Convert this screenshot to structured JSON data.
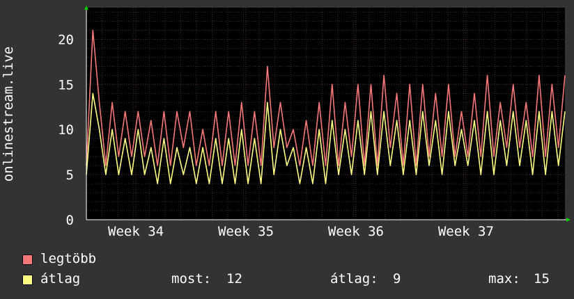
{
  "chart_data": {
    "type": "line",
    "ylabel": "onlinestream.live",
    "yticks": [
      0,
      5,
      10,
      15,
      20
    ],
    "ylim": [
      0,
      23.5
    ],
    "xlim": [
      33.55,
      37.9
    ],
    "xticks": [
      {
        "label": "Week 34",
        "x": 34
      },
      {
        "label": "Week 35",
        "x": 35
      },
      {
        "label": "Week 36",
        "x": 36
      },
      {
        "label": "Week 37",
        "x": 37
      }
    ],
    "grid": true,
    "series": [
      {
        "name": "legtöbb",
        "color": "#f87878",
        "values": [
          6,
          21,
          13,
          6,
          13,
          7,
          12,
          7,
          12,
          7,
          11,
          6,
          12,
          6,
          12,
          8,
          12,
          6,
          10,
          6,
          12,
          6,
          12,
          6,
          13,
          6,
          12,
          6,
          17,
          8,
          13,
          8,
          10,
          6,
          11,
          6,
          13,
          6,
          15,
          6,
          13,
          7,
          15,
          6,
          15,
          6,
          16,
          8,
          14,
          6,
          15,
          6,
          15,
          7,
          14,
          7,
          15,
          7,
          12,
          7,
          14,
          7,
          16,
          7,
          13,
          8,
          15,
          8,
          13,
          7,
          16,
          7,
          15,
          8,
          16
        ]
      },
      {
        "name": "átlag",
        "color": "#ffff80",
        "values": [
          5,
          14,
          10,
          5,
          10,
          5,
          9,
          5,
          10,
          5,
          8,
          4,
          9,
          4,
          8,
          5,
          8,
          4,
          8,
          4,
          9,
          4,
          9,
          4,
          10,
          4,
          9,
          4,
          13,
          5,
          10,
          6,
          8,
          4,
          8,
          4,
          10,
          4,
          11,
          5,
          10,
          5,
          11,
          5,
          12,
          5,
          12,
          6,
          11,
          5,
          11,
          5,
          12,
          6,
          11,
          5,
          12,
          6,
          10,
          6,
          11,
          5,
          12,
          5,
          11,
          6,
          12,
          6,
          11,
          5,
          12,
          5,
          12,
          6,
          12
        ]
      }
    ]
  },
  "legend": {
    "max_label": "legtöbb",
    "avg_label": "átlag",
    "stats": {
      "most_label": "most:",
      "most_value": "12",
      "avg_label": "átlag:",
      "avg_value": "9",
      "max_label": "max:",
      "max_value": "15"
    }
  }
}
